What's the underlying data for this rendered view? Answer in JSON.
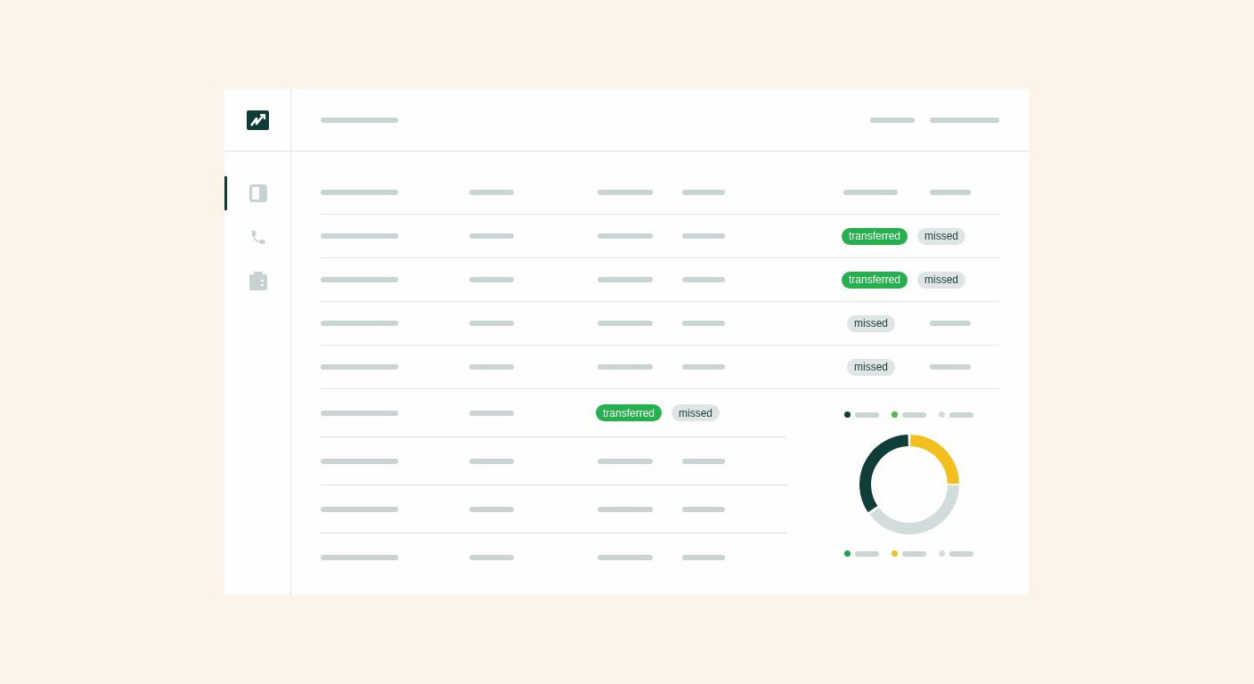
{
  "sidebar": {
    "items": [
      {
        "selected": true
      },
      {
        "selected": false
      },
      {
        "selected": false
      }
    ]
  },
  "table": {
    "rows": [
      {
        "cells": [
          {
            "kind": "line"
          },
          {
            "kind": "line"
          },
          {
            "kind": "line"
          },
          {
            "kind": "line"
          },
          {
            "kind": "badges",
            "badges": [
              {
                "label": "transferred",
                "kind": "success"
              },
              {
                "label": "missed",
                "kind": "neutral"
              }
            ]
          }
        ]
      },
      {
        "cells": [
          {
            "kind": "line"
          },
          {
            "kind": "line"
          },
          {
            "kind": "line"
          },
          {
            "kind": "line"
          },
          {
            "kind": "badges",
            "badges": [
              {
                "label": "transferred",
                "kind": "success"
              },
              {
                "label": "missed",
                "kind": "neutral"
              }
            ]
          }
        ]
      },
      {
        "cells": [
          {
            "kind": "line"
          },
          {
            "kind": "line"
          },
          {
            "kind": "line"
          },
          {
            "kind": "line"
          },
          {
            "kind": "badges",
            "badges": [
              {
                "label": "missed",
                "kind": "neutral"
              }
            ]
          },
          {
            "kind": "line"
          }
        ]
      },
      {
        "cells": [
          {
            "kind": "line"
          },
          {
            "kind": "line"
          },
          {
            "kind": "line"
          },
          {
            "kind": "line"
          },
          {
            "kind": "badges",
            "badges": [
              {
                "label": "missed",
                "kind": "neutral"
              }
            ]
          },
          {
            "kind": "line"
          }
        ]
      },
      {
        "cells": [
          {
            "kind": "line"
          },
          {
            "kind": "line"
          },
          {
            "kind": "badges",
            "badges": [
              {
                "label": "transferred",
                "kind": "success"
              },
              {
                "label": "missed",
                "kind": "neutral"
              }
            ]
          }
        ]
      },
      {
        "cells": [
          {
            "kind": "line"
          },
          {
            "kind": "line"
          },
          {
            "kind": "line"
          },
          {
            "kind": "line"
          }
        ]
      },
      {
        "cells": [
          {
            "kind": "line"
          },
          {
            "kind": "line"
          },
          {
            "kind": "line"
          },
          {
            "kind": "line"
          }
        ]
      },
      {
        "cells": [
          {
            "kind": "line"
          },
          {
            "kind": "line"
          },
          {
            "kind": "line"
          },
          {
            "kind": "line"
          }
        ]
      }
    ]
  },
  "chart": {
    "legend_top": [
      {
        "color": "#0f3d37"
      },
      {
        "color": "#4cba4c"
      },
      {
        "color": "#d3dcdc"
      }
    ],
    "legend_bottom": [
      {
        "color": "#21a04b"
      },
      {
        "color": "#f2bf1c"
      },
      {
        "color": "#d3dcdc"
      }
    ]
  }
}
